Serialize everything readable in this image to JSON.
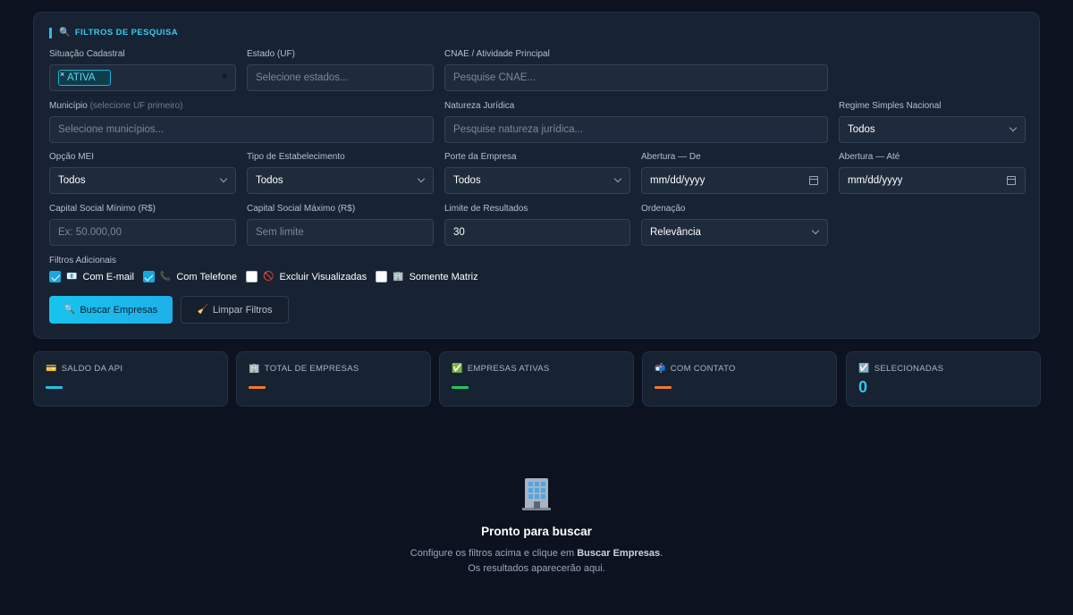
{
  "filters": {
    "section_title": "FILTROS DE PESQUISA",
    "situacao": {
      "label": "Situação Cadastral",
      "tag_remove": "×",
      "tag": "ATIVA",
      "clear": "×"
    },
    "estado": {
      "label": "Estado (UF)",
      "placeholder": "Selecione estados..."
    },
    "cnae": {
      "label": "CNAE / Atividade Principal",
      "placeholder": "Pesquise CNAE..."
    },
    "municipio": {
      "label": "Município",
      "hint": "(selecione UF primeiro)",
      "placeholder": "Selecione municípios..."
    },
    "natureza": {
      "label": "Natureza Jurídica",
      "placeholder": "Pesquise natureza jurídica..."
    },
    "simples": {
      "label": "Regime Simples Nacional",
      "value": "Todos"
    },
    "mei": {
      "label": "Opção MEI",
      "value": "Todos"
    },
    "tipo": {
      "label": "Tipo de Estabelecimento",
      "value": "Todos"
    },
    "porte": {
      "label": "Porte da Empresa",
      "value": "Todos"
    },
    "abertura_de": {
      "label": "Abertura — De",
      "value": "mm/dd/yyyy"
    },
    "abertura_ate": {
      "label": "Abertura — Até",
      "value": "mm/dd/yyyy"
    },
    "capital_min": {
      "label": "Capital Social Mínimo (R$)",
      "placeholder": "Ex: 50.000,00"
    },
    "capital_max": {
      "label": "Capital Social Máximo (R$)",
      "placeholder": "Sem limite"
    },
    "limite": {
      "label": "Limite de Resultados",
      "value": "30"
    },
    "ordenacao": {
      "label": "Ordenação",
      "value": "Relevância"
    },
    "adicionais": {
      "label": "Filtros Adicionais",
      "items": [
        {
          "label": "Com E-mail",
          "checked": true
        },
        {
          "label": "Com Telefone",
          "checked": true
        },
        {
          "label": "Excluir Visualizadas",
          "checked": false
        },
        {
          "label": "Somente Matriz",
          "checked": false
        }
      ]
    },
    "buttons": {
      "search": "Buscar Empresas",
      "clear": "Limpar Filtros"
    }
  },
  "stats": [
    {
      "title": "SALDO DA API",
      "bar_color": "#22c2e8"
    },
    {
      "title": "TOTAL DE EMPRESAS",
      "bar_color": "#f07a2a"
    },
    {
      "title": "EMPRESAS ATIVAS",
      "bar_color": "#22c55e"
    },
    {
      "title": "COM CONTATO",
      "bar_color": "#f07a2a"
    },
    {
      "title": "SELECIONADAS",
      "value": "0"
    }
  ],
  "empty_state": {
    "heading": "Pronto para buscar",
    "line1_prefix": "Configure os filtros acima e clique em ",
    "line1_bold": "Buscar Empresas",
    "line1_suffix": ".",
    "line2": "Os resultados aparecerão aqui."
  },
  "icons": {
    "search": "🔍",
    "email": "📧",
    "phone": "📞",
    "blocked": "🚫",
    "building": "🏢",
    "broom": "🧹",
    "card": "💳",
    "check": "✅",
    "mailbox": "📬",
    "checkbox": "☑️"
  }
}
